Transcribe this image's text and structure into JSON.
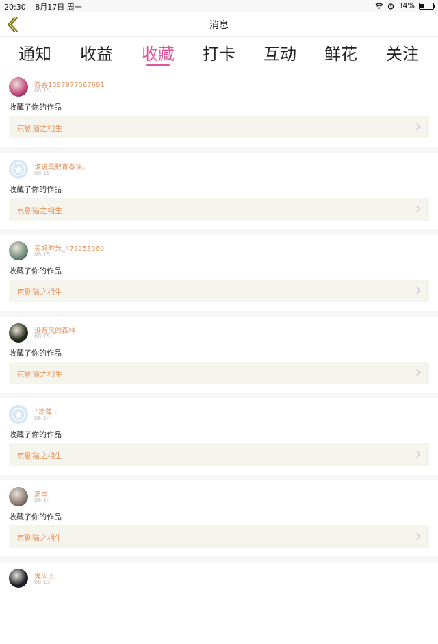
{
  "status_bar": {
    "time": "20:30",
    "date": "8月17日 周一",
    "battery": "34%",
    "battery_level": 0.34
  },
  "nav": {
    "title": "消息"
  },
  "tabs": [
    {
      "label": "通知",
      "active": false
    },
    {
      "label": "收益",
      "active": false
    },
    {
      "label": "收藏",
      "active": true
    },
    {
      "label": "打卡",
      "active": false
    },
    {
      "label": "互动",
      "active": false
    },
    {
      "label": "鲜花",
      "active": false
    },
    {
      "label": "关注",
      "active": false
    }
  ],
  "items": [
    {
      "username": "游客1587977567691",
      "date": "08-15",
      "action": "收藏了你的作品",
      "work": "京剧猫之相生",
      "avatar": "photo",
      "avatar_color": "#c2477a"
    },
    {
      "username": "谁说莫把青春误。",
      "date": "08-15",
      "action": "收藏了你的作品",
      "work": "京剧猫之相生",
      "avatar": "default",
      "avatar_color": "#d6e7f6"
    },
    {
      "username": "美好时光_479253060",
      "date": "08-15",
      "action": "收藏了你的作品",
      "work": "京剧猫之相生",
      "avatar": "photo",
      "avatar_color": "#6f8d7a"
    },
    {
      "username": "没有风的森林",
      "date": "08-15",
      "action": "收藏了你的作品",
      "work": "京剧猫之相生",
      "avatar": "photo",
      "avatar_color": "#1f2a14"
    },
    {
      "username": "╰凉薄~",
      "date": "08-14",
      "action": "收藏了你的作品",
      "work": "京剧猫之相生",
      "avatar": "default",
      "avatar_color": "#d6e7f6"
    },
    {
      "username": "离雪",
      "date": "08-14",
      "action": "收藏了你的作品",
      "work": "京剧猫之相生",
      "avatar": "photo",
      "avatar_color": "#8a7a70"
    },
    {
      "username": "鬼火王",
      "date": "08-13",
      "action": "",
      "work": "",
      "avatar": "photo",
      "avatar_color": "#1a1c26"
    }
  ],
  "colors": {
    "accent": "#e0559a",
    "link": "#e8945f",
    "back_icon": "#8a7a1a"
  }
}
